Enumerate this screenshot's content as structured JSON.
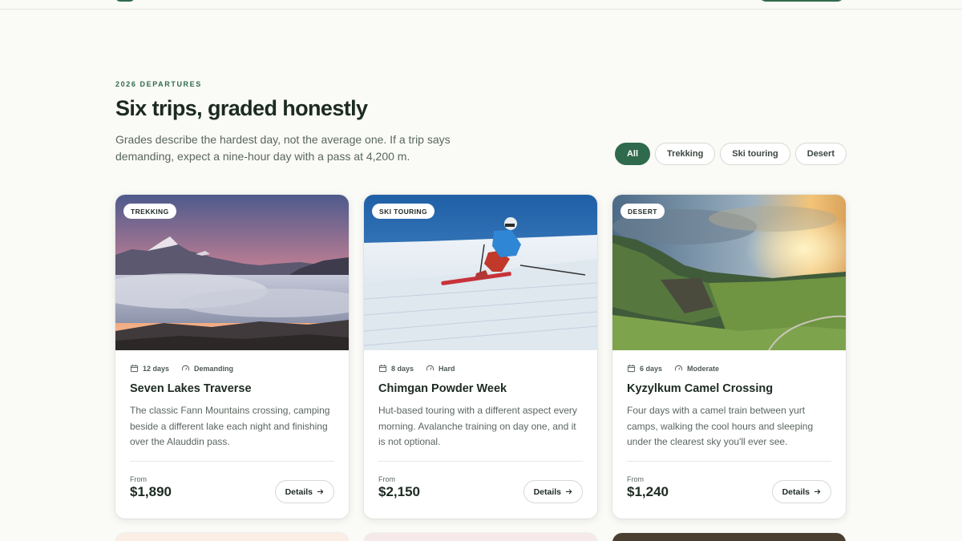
{
  "section": {
    "eyebrow": "2026 DEPARTURES",
    "title": "Six trips, graded honestly",
    "intro": "Grades describe the hardest day, not the average one. If a trip says demanding, expect a nine-hour day with a pass at 4,200 m."
  },
  "filters": [
    {
      "label": "All",
      "active": true
    },
    {
      "label": "Trekking",
      "active": false
    },
    {
      "label": "Ski touring",
      "active": false
    },
    {
      "label": "Desert",
      "active": false
    }
  ],
  "cards": [
    {
      "badge": "TREKKING",
      "days": "12 days",
      "grade": "Demanding",
      "title": "Seven Lakes Traverse",
      "description": "The classic Fann Mountains crossing, camping beside a different lake each night and finishing over the Alauddin pass.",
      "from_label": "From",
      "price": "$1,890",
      "details_label": "Details",
      "image_icon": "mountain-sunset-image"
    },
    {
      "badge": "SKI TOURING",
      "days": "8 days",
      "grade": "Hard",
      "title": "Chimgan Powder Week",
      "description": "Hut-based touring with a different aspect every morning. Avalanche training on day one, and it is not optional.",
      "from_label": "From",
      "price": "$2,150",
      "details_label": "Details",
      "image_icon": "skier-image"
    },
    {
      "badge": "DESERT",
      "days": "6 days",
      "grade": "Moderate",
      "title": "Kyzylkum Camel Crossing",
      "description": "Four days with a camel train between yurt camps, walking the cool hours and sleeping under the clearest sky you'll ever see.",
      "from_label": "From",
      "price": "$1,240",
      "details_label": "Details",
      "image_icon": "green-valley-image"
    }
  ],
  "colors": {
    "accent": "#2f6a4c",
    "background": "#fafaf6",
    "text": "#1c2a22",
    "muted": "#5a665f"
  },
  "icons": {
    "calendar": "calendar-icon",
    "grade": "gauge-icon",
    "arrow": "arrow-right-icon"
  }
}
